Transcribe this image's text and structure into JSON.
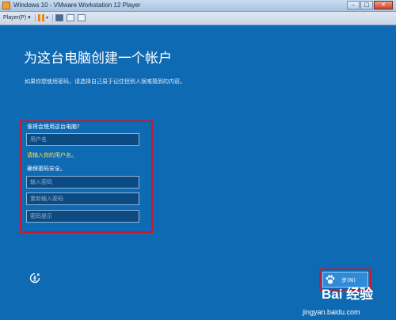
{
  "window": {
    "title": "Windows 10 - VMware Workstation 12 Player",
    "controls": {
      "minimize": "–",
      "maximize": "□",
      "close": "✕"
    }
  },
  "toolbar": {
    "player_label": "Player(P)",
    "icons": [
      "pause-icon",
      "send-ctrl-alt-del-icon",
      "fit-guest-icon",
      "unity-icon"
    ]
  },
  "setup": {
    "heading": "为这台电脑创建一个帐户",
    "subtext": "如果你想使用密码，请选择自己易于记住但别人很难猜到的内容。",
    "username_label": "谁将会使用这台电脑?",
    "username_placeholder": "用户名",
    "username_hint": "请输入你的用户名。",
    "password_label": "确保密码安全。",
    "password_placeholder": "输入密码",
    "confirm_placeholder": "重新输入密码",
    "hint_placeholder": "密码提示",
    "next_button": "步(N)"
  },
  "watermark": {
    "logo_text": "Bai  经验",
    "url": "jingyan.baidu.com"
  },
  "colors": {
    "background": "#0f6ab4",
    "highlight": "#d0162a",
    "hint": "#ffe14a",
    "field": "#0c4a82"
  }
}
